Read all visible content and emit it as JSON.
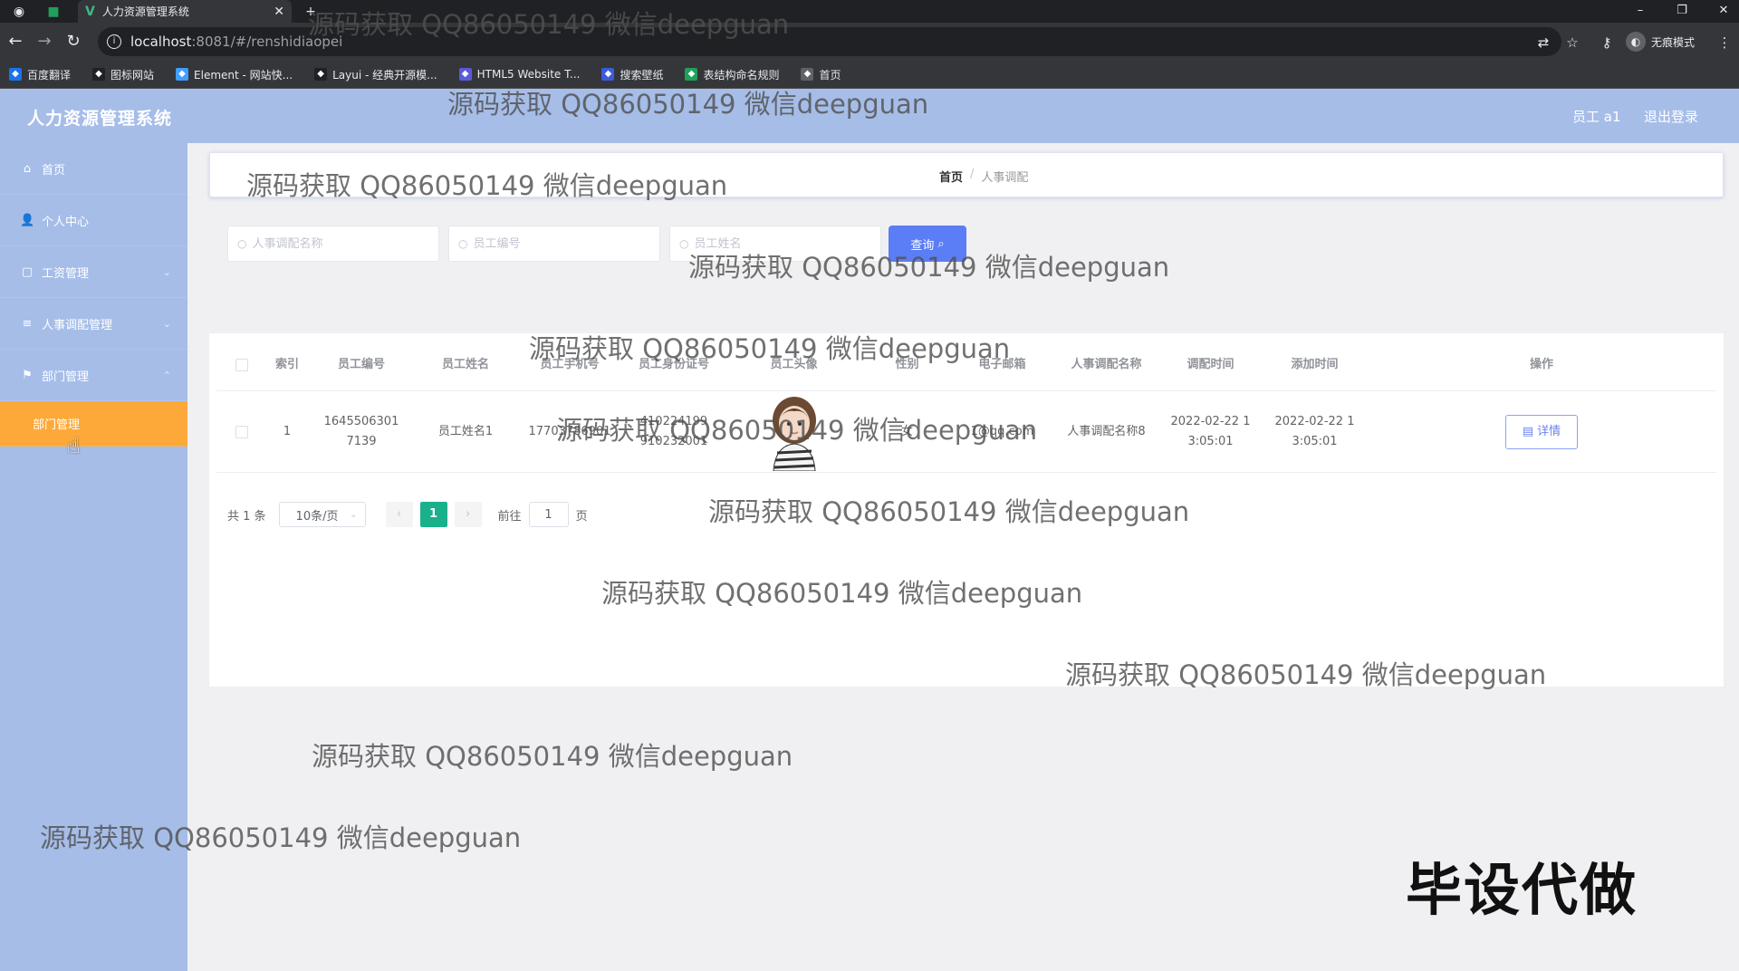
{
  "browser": {
    "tab_title": "人力资源管理系统",
    "url_host": "localhost",
    "url_rest": ":8081/#/renshidiaopei",
    "incognito_label": "无痕模式",
    "bookmarks": [
      {
        "label": "百度翻译",
        "color": "#1a73e8"
      },
      {
        "label": "图标网站",
        "color": "#202124"
      },
      {
        "label": "Element - 网站快...",
        "color": "#409eff"
      },
      {
        "label": "Layui - 经典开源模...",
        "color": "#202124"
      },
      {
        "label": "HTML5 Website T...",
        "color": "#5b5bd6"
      },
      {
        "label": "搜索壁纸",
        "color": "#3b5bdb"
      },
      {
        "label": "表结构命名规则",
        "color": "#20a05a"
      },
      {
        "label": "首页",
        "color": "#5f6368"
      }
    ]
  },
  "header": {
    "title": "人力资源管理系统",
    "user": "员工 a1",
    "logout": "退出登录"
  },
  "sidebar": {
    "items": [
      {
        "label": "首页"
      },
      {
        "label": "个人中心"
      },
      {
        "label": "工资管理"
      },
      {
        "label": "人事调配管理"
      },
      {
        "label": "部门管理"
      },
      {
        "label": "部门管理"
      }
    ]
  },
  "breadcrumb": {
    "home": "首页",
    "separator": "/",
    "current": "人事调配"
  },
  "search": {
    "f1_placeholder": "人事调配名称",
    "f2_placeholder": "员工编号",
    "f3_placeholder": "员工姓名",
    "query_label": "查询"
  },
  "table": {
    "headers": [
      "索引",
      "员工编号",
      "员工姓名",
      "员工手机号",
      "员工身份证号",
      "员工头像",
      "性别",
      "电子邮箱",
      "人事调配名称",
      "调配时间",
      "添加时间",
      "操作"
    ],
    "rows": [
      {
        "index": "1",
        "emp_no": "16455063017139",
        "emp_name": "员工姓名1",
        "phone": "17703786901",
        "id_card": "410224199910232001",
        "gender": "女",
        "email": "1@qq.com",
        "transfer_name": "人事调配名称8",
        "transfer_time": "2022-02-22 13:05:01",
        "add_time": "2022-02-22 13:05:01",
        "detail_label": "详情"
      }
    ]
  },
  "pagination": {
    "total": "共 1 条",
    "page_size": "10条/页",
    "current_page": "1",
    "goto_prefix": "前往",
    "goto_value": "1",
    "goto_suffix": "页"
  },
  "watermark": "源码获取 QQ86050149 微信deepguan",
  "stamp": "毕设代做",
  "colors": {
    "header_bg": "#a6bde8",
    "active_menu": "#fda93a",
    "primary_button": "#5b7df5",
    "page_active": "#1bb08c"
  }
}
